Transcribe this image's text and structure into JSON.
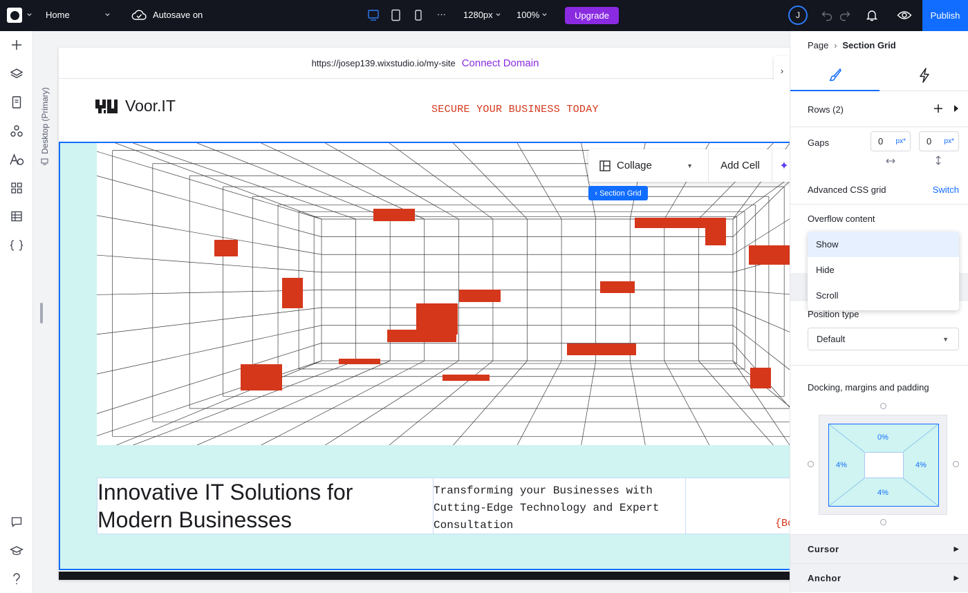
{
  "topbar": {
    "page_name": "Home",
    "autosave": "Autosave on",
    "width_value": "1280px",
    "zoom_value": "100%",
    "upgrade_label": "Upgrade",
    "avatar_initial": "J",
    "publish_label": "Publish",
    "more_glyph": "···"
  },
  "canvas": {
    "viewport_label": "Desktop (Primary)",
    "url": "https://josep139.wixstudio.io/my-site",
    "connect_domain": "Connect Domain",
    "next_arrow": "›"
  },
  "site": {
    "brand_name": "Voor.IT",
    "tagline": "SECURE YOUR BUSINESS TODAY",
    "headline": "Innovative IT Solutions for Modern Businesses",
    "subheadline": "Transforming your Businesses with Cutting-Edge Technology and Expert Consultation",
    "button_partial": "{Bo",
    "accent_color": "#d5371b",
    "section_bg": "#cff4f1"
  },
  "toolbar": {
    "layout_label": "Collage",
    "add_cell_label": "Add Cell",
    "section_grid_label": "‹ Section Grid"
  },
  "panel": {
    "breadcrumb": [
      "Page",
      "Section Grid"
    ],
    "breadcrumb_sep": "›",
    "rows_label": "Rows (2)",
    "gaps_label": "Gaps",
    "gap_h_value": "0",
    "gap_v_value": "0",
    "gap_unit": "px*",
    "advanced_label": "Advanced CSS grid",
    "switch_label": "Switch",
    "overflow_label": "Overflow content",
    "overflow_options": [
      "Show",
      "Hide",
      "Scroll"
    ],
    "overflow_selected": "Show",
    "position_label": "Position type",
    "position_value": "Default",
    "docking_label": "Docking, margins and padding",
    "margin_top": "0%",
    "margin_left": "4%",
    "margin_right": "4%",
    "margin_bottom": "4%",
    "cursor_label": "Cursor",
    "anchor_label": "Anchor"
  },
  "colors": {
    "topbar_bg": "#13151f",
    "publish_blue": "#116dff",
    "upgrade_purple": "#8a2be2"
  }
}
